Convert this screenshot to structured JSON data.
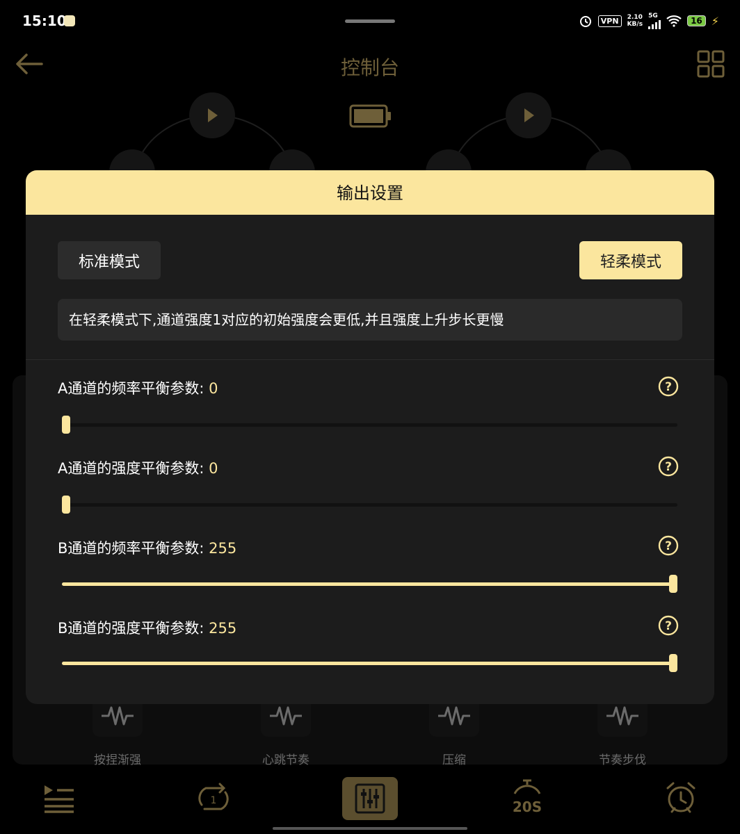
{
  "status_bar": {
    "time": "15:10",
    "vpn": "VPN",
    "speed_value": "2.10",
    "speed_unit": "KB/s",
    "network": "5G",
    "battery": "16"
  },
  "header": {
    "title": "控制台"
  },
  "modal": {
    "title": "输出设置",
    "mode_standard": "标准模式",
    "mode_soft": "轻柔模式",
    "selected_mode": "轻柔模式",
    "note": "在轻柔模式下,通道强度1对应的初始强度会更低,并且强度上升步长更慢",
    "params": [
      {
        "label": "A通道的频率平衡参数:",
        "value": "0",
        "fraction": 0.0
      },
      {
        "label": "A通道的强度平衡参数:",
        "value": "0",
        "fraction": 0.0
      },
      {
        "label": "B通道的频率平衡参数:",
        "value": "255",
        "fraction": 1.0
      },
      {
        "label": "B通道的强度平衡参数:",
        "value": "255",
        "fraction": 1.0
      }
    ]
  },
  "background": {
    "presets": [
      "按捏渐强",
      "心跳节奏",
      "压缩",
      "节奏步伐"
    ]
  },
  "bottom_nav": {
    "timer_label": "20S",
    "loop_label": "1"
  },
  "colors": {
    "accent": "#fbe69e",
    "modal_bg": "#1c1c1c",
    "page_bg": "#000000"
  }
}
